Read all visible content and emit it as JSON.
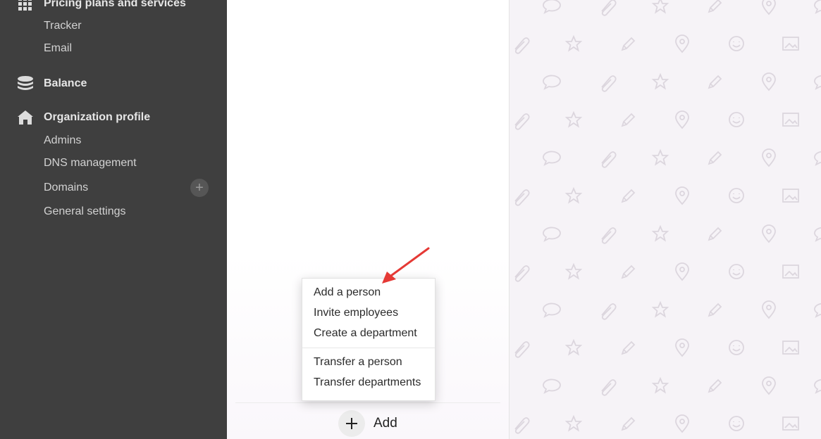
{
  "sidebar": {
    "pricing_label": "Pricing plans and services",
    "items_top": [
      "Tracker",
      "Email"
    ],
    "balance_label": "Balance",
    "org_label": "Organization profile",
    "items_org": [
      "Admins",
      "DNS management",
      "Domains",
      "General settings"
    ],
    "domains_add_icon": "plus-icon"
  },
  "menu": {
    "items": [
      "Add a person",
      "Invite employees",
      "Create a department"
    ],
    "transfer_items": [
      "Transfer a person",
      "Transfer departments"
    ]
  },
  "add_button": {
    "label": "Add",
    "icon": "plus-icon"
  },
  "colors": {
    "sidebar_bg": "#3f3f3f",
    "pattern_bg": "#f6f3f7",
    "arrow": "#e53935"
  }
}
